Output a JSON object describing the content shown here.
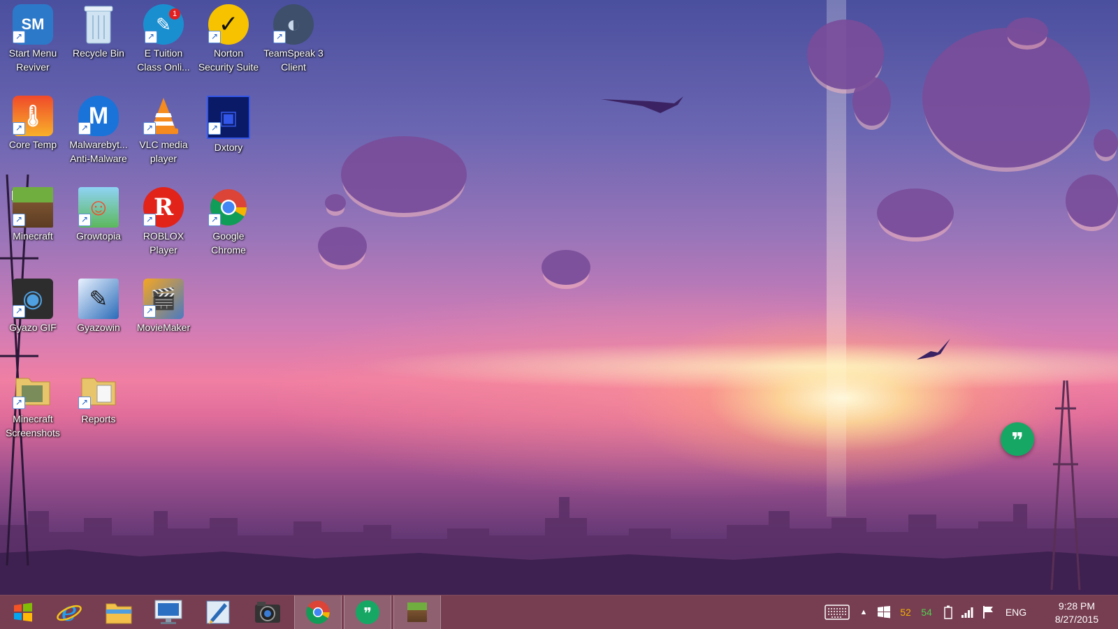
{
  "desktop": {
    "icons": [
      {
        "label": "Start Menu\nReviver",
        "icon": "start-menu-reviver-icon",
        "glyph": "SM",
        "bg": "#2c79c9"
      },
      {
        "label": "Recycle Bin",
        "icon": "recycle-bin-icon",
        "glyph": "🗑",
        "bg": "transparent"
      },
      {
        "label": "E Tuition\nClass Onli...",
        "icon": "e-tuition-icon",
        "glyph": "✎",
        "bg": "#1a8fd0",
        "badge": "1"
      },
      {
        "label": "Norton\nSecurity Suite",
        "icon": "norton-icon",
        "glyph": "✓",
        "bg": "#f7c200"
      },
      {
        "label": "TeamSpeak 3\nClient",
        "icon": "teamspeak-icon",
        "glyph": "◐",
        "bg": "#3d4f6b"
      },
      {
        "label": "Core Temp",
        "icon": "core-temp-icon",
        "glyph": "🌡",
        "bg": "#f08a24"
      },
      {
        "label": "Malwarebyt...\nAnti-Malware",
        "icon": "malwarebytes-icon",
        "glyph": "M",
        "bg": "#1a73d9"
      },
      {
        "label": "VLC media\nplayer",
        "icon": "vlc-icon",
        "glyph": "▲",
        "bg": "transparent"
      },
      {
        "label": "Dxtory",
        "icon": "dxtory-icon",
        "glyph": "▣",
        "bg": "#0b1a66"
      },
      {
        "label": "Minecraft",
        "icon": "minecraft-icon",
        "glyph": "",
        "bg": "#5d8f3a"
      },
      {
        "label": "Growtopia",
        "icon": "growtopia-icon",
        "glyph": "☺",
        "bg": "#7cc4f0"
      },
      {
        "label": "ROBLOX\nPlayer",
        "icon": "roblox-icon",
        "glyph": "R",
        "bg": "#e2231a"
      },
      {
        "label": "Google\nChrome",
        "icon": "chrome-icon",
        "glyph": "",
        "bg": "transparent"
      },
      {
        "label": "Gyazo GIF",
        "icon": "gyazo-gif-icon",
        "glyph": "◉",
        "bg": "#2d2d2d"
      },
      {
        "label": "Gyazowin",
        "icon": "gyazowin-icon",
        "glyph": "✎",
        "bg": "#2a6bb8"
      },
      {
        "label": "MovieMaker",
        "icon": "moviemaker-icon",
        "glyph": "🎬",
        "bg": "#4a7ac0"
      },
      {
        "label": "Minecraft\nScreenshots",
        "icon": "folder-icon",
        "glyph": "",
        "bg": "#e8c56a"
      },
      {
        "label": "Reports",
        "icon": "folder-icon",
        "glyph": "",
        "bg": "#e8c56a"
      }
    ]
  },
  "taskbar": {
    "apps": [
      {
        "name": "start-button",
        "icon": "windows-logo-icon"
      },
      {
        "name": "internet-explorer-button",
        "icon": "internet-explorer-icon"
      },
      {
        "name": "file-explorer-button",
        "icon": "folder-icon"
      },
      {
        "name": "monitor-app-button",
        "icon": "monitor-icon"
      },
      {
        "name": "gyazowin-taskbar-button",
        "icon": "gyazowin-icon"
      },
      {
        "name": "gyazo-gif-taskbar-button",
        "icon": "camera-icon"
      },
      {
        "name": "chrome-taskbar-button",
        "icon": "chrome-icon"
      },
      {
        "name": "hangouts-taskbar-button",
        "icon": "hangouts-icon"
      },
      {
        "name": "minecraft-taskbar-button",
        "icon": "minecraft-icon"
      }
    ],
    "tray": {
      "temp1": "52",
      "temp2": "54",
      "language": "ENG",
      "time": "9:28 PM",
      "date": "8/27/2015"
    }
  },
  "colors": {
    "taskbar": "#703448",
    "hangouts_green": "#16a765",
    "temp1": "#f3b300",
    "temp2": "#4fd14f"
  }
}
